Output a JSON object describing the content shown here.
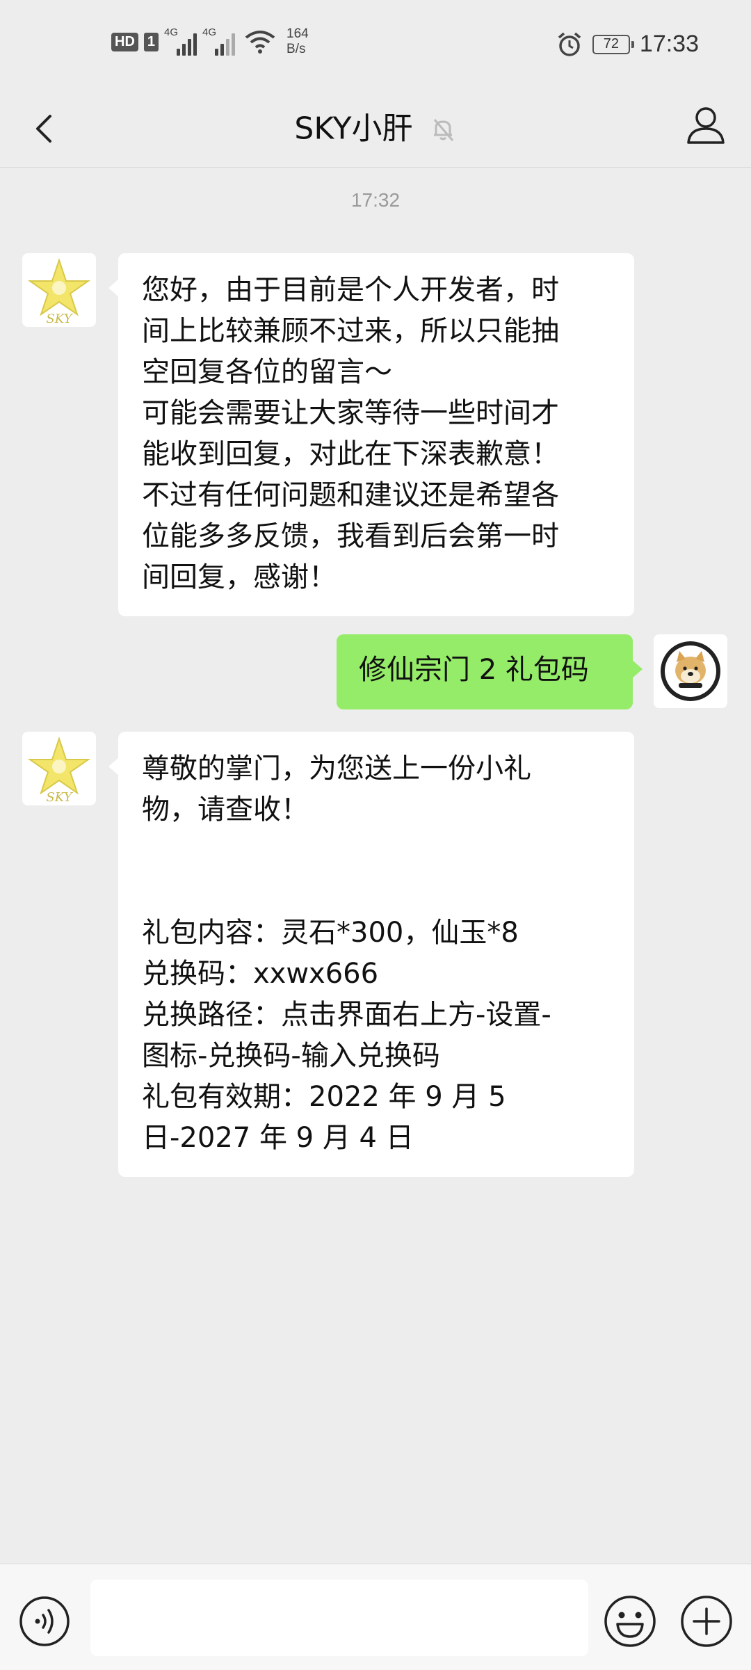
{
  "status_bar": {
    "hd": "HD",
    "sim": "1",
    "network1": "4G",
    "network2": "4G",
    "speed_value": "164",
    "speed_unit": "B/s",
    "battery": "72",
    "time": "17:33"
  },
  "header": {
    "title": "SKY小肝"
  },
  "chat": {
    "timestamp": "17:32",
    "messages": [
      {
        "side": "in",
        "lines": [
          "您好，由于目前是个人开发者，时",
          "间上比较兼顾不过来，所以只能抽",
          "空回复各位的留言～",
          "可能会需要让大家等待一些时间才",
          "能收到回复，对此在下深表歉意！",
          "不过有任何问题和建议还是希望各",
          "位能多多反馈，我看到后会第一时",
          "间回复，感谢！"
        ]
      },
      {
        "side": "out",
        "lines": [
          "修仙宗门 2 礼包码"
        ]
      },
      {
        "side": "in",
        "lines": [
          "尊敬的掌门，为您送上一份小礼",
          "物，请查收！",
          "",
          "",
          "礼包内容：灵石*300，仙玉*8",
          "兑换码：xxwx666",
          "兑换路径：点击界面右上方-设置-",
          "图标-兑换码-输入兑换码",
          "礼包有效期：2022 年 9 月 5",
          "日-2027 年 9 月 4 日"
        ]
      }
    ]
  },
  "avatars": {
    "sky_text": "SKY"
  },
  "input": {
    "value": ""
  },
  "icons": {
    "back": "chevron-left-icon",
    "mute": "bell-off-icon",
    "profile": "person-icon",
    "voice": "voice-icon",
    "emoji": "emoji-icon",
    "plus": "plus-icon"
  }
}
